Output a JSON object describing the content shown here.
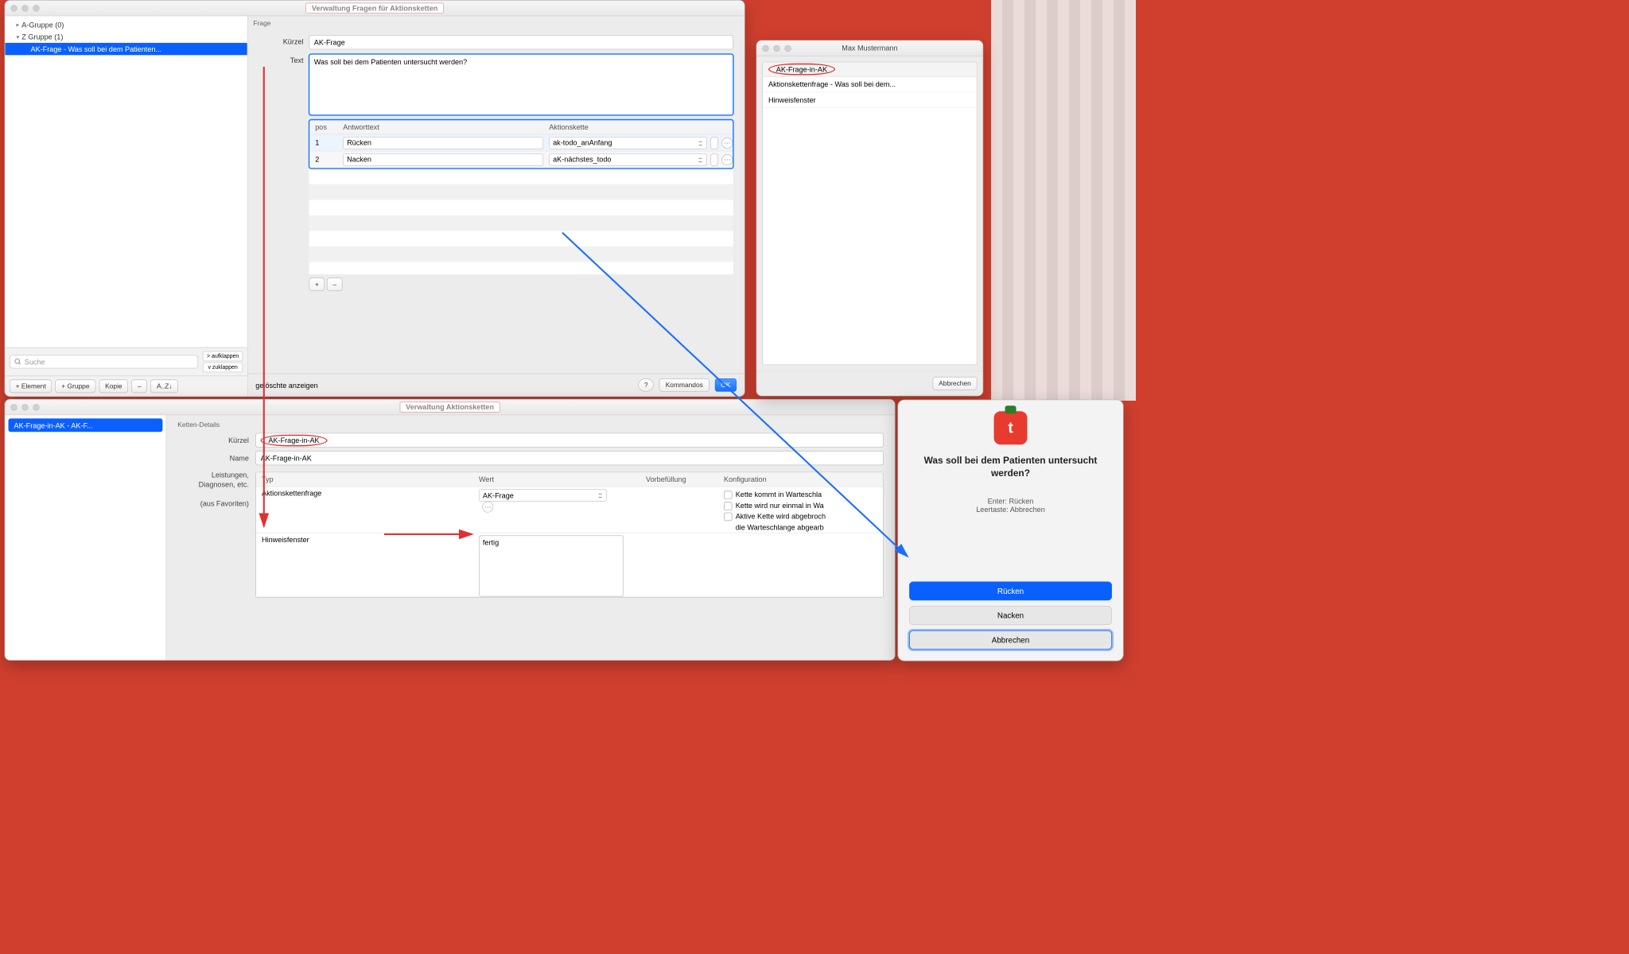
{
  "win1": {
    "title": "Verwaltung Fragen für Aktionsketten",
    "tree": {
      "group_a": "A-Gruppe (0)",
      "group_z": "Z Gruppe (1)",
      "item_sel": "AK-Frage - Was soll bei dem Patienten..."
    },
    "search_placeholder": "Suche",
    "expand": "> aufklappen",
    "collapse": "v  zuklappen",
    "toolbar": {
      "add_element": "+ Element",
      "add_group": "+ Gruppe",
      "copy": "Kopie",
      "minus": "–",
      "sort": "A..Z↓"
    },
    "section": "Frage",
    "labels": {
      "kuerzel": "Kürzel",
      "text": "Text"
    },
    "kuerzel_value": "AK-Frage",
    "text_value": "Was soll bei dem Patienten untersucht werden?",
    "cols": {
      "pos": "pos",
      "answer": "Antworttext",
      "ak": "Aktionskette"
    },
    "rows": [
      {
        "pos": "1",
        "answer": "Rücken",
        "ak": "ak-todo_anAnfang"
      },
      {
        "pos": "2",
        "answer": "Nacken",
        "ak": "aK-nächstes_todo"
      }
    ],
    "footer": {
      "deleted": "gelöschte anzeigen",
      "help": "?",
      "kommandos": "Kommandos",
      "ok": "OK"
    }
  },
  "win2": {
    "title": "Verwaltung Aktionsketten",
    "side_item": "AK-Frage-in-AK - AK-F...",
    "section": "Ketten-Details",
    "labels": {
      "kuerzel": "Kürzel",
      "name": "Name",
      "leist": "Leistungen, Diagnosen, etc.",
      "fav": "(aus Favoriten)"
    },
    "kuerzel_value": "AK-Frage-in-AK",
    "name_value": "AK-Frage-in-AK",
    "cols": {
      "typ": "Typ",
      "wert": "Wert",
      "vor": "Vorbefüllung",
      "konf": "Konfiguration"
    },
    "row1": {
      "typ": "Aktionskettenfrage",
      "wert": "AK-Frage"
    },
    "konf_checks": [
      "Kette kommt in Warteschla",
      "Kette wird nur einmal in Wa",
      "Aktive Kette wird abgebroch",
      "die Warteschlange abgearb"
    ],
    "row2": {
      "typ": "Hinweisfenster",
      "wert": "fertig"
    }
  },
  "win3": {
    "title": "Max Mustermann",
    "header": "AK-Frage-in-AK",
    "items": [
      "Aktionskettenfrage - Was soll bei dem...",
      "Hinweisfenster"
    ],
    "cancel": "Abbrechen"
  },
  "win4": {
    "question": "Was soll bei dem Patienten untersucht werden?",
    "hint_enter": "Enter: Rücken",
    "hint_space": "Leertaste: Abbrechen",
    "btn_primary": "Rücken",
    "btn_secondary": "Nacken",
    "btn_cancel": "Abbrechen"
  }
}
